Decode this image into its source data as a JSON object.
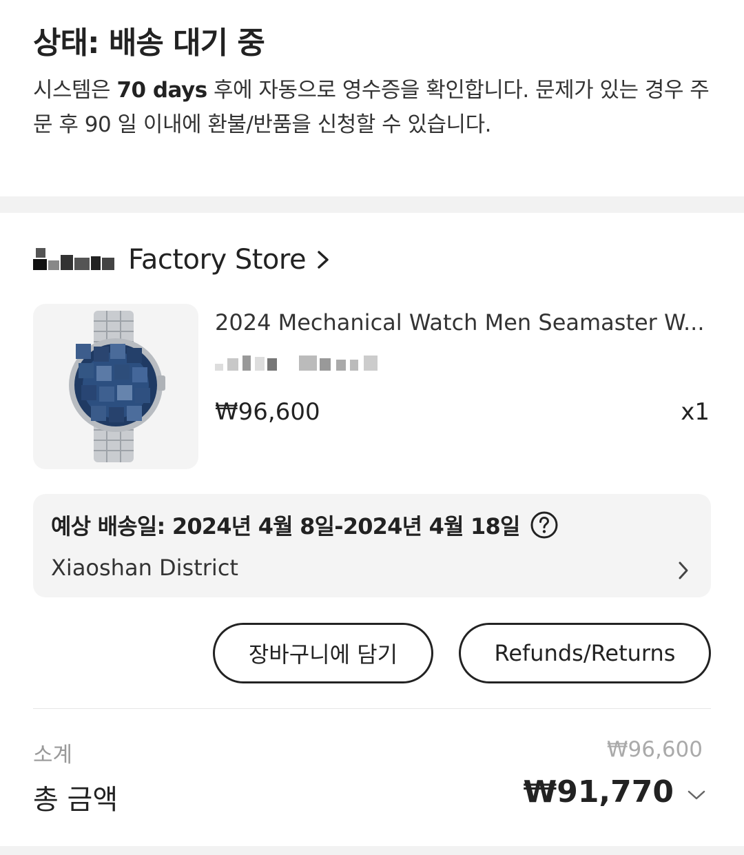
{
  "status": {
    "title": "상태: 배송 대기 중",
    "desc_pre": "시스템은 ",
    "desc_days": "70 days",
    "desc_post": " 후에 자동으로 영수증을 확인합니다. 문제가 있는 경우 주문 후 90 일 이내에 환불/반품을 신청할 수 있습니다."
  },
  "store": {
    "name": "Factory Store",
    "chevron_icon": "chevron-right-icon"
  },
  "product": {
    "title": "2024 Mechanical Watch Men Seamaster W...",
    "price": "₩96,600",
    "quantity": "x1",
    "image_icon": "watch-image"
  },
  "delivery": {
    "label": "예상 배송일: 2024년 4월 8일-2024년 4월 18일",
    "help_icon": "question-circle-icon",
    "address": "Xiaoshan District"
  },
  "actions": {
    "cart_label": "장바구니에 담기",
    "refund_label": "Refunds/Returns"
  },
  "summary": {
    "subtotal_label": "소계",
    "subtotal_value": "₩96,600",
    "total_label": "총 금액",
    "total_value": "₩91,770"
  },
  "colors": {
    "text": "#222222",
    "muted": "#999999",
    "panel": "#f4f4f4",
    "band": "#f2f2f2",
    "watch_dial": "#2c4f80"
  }
}
